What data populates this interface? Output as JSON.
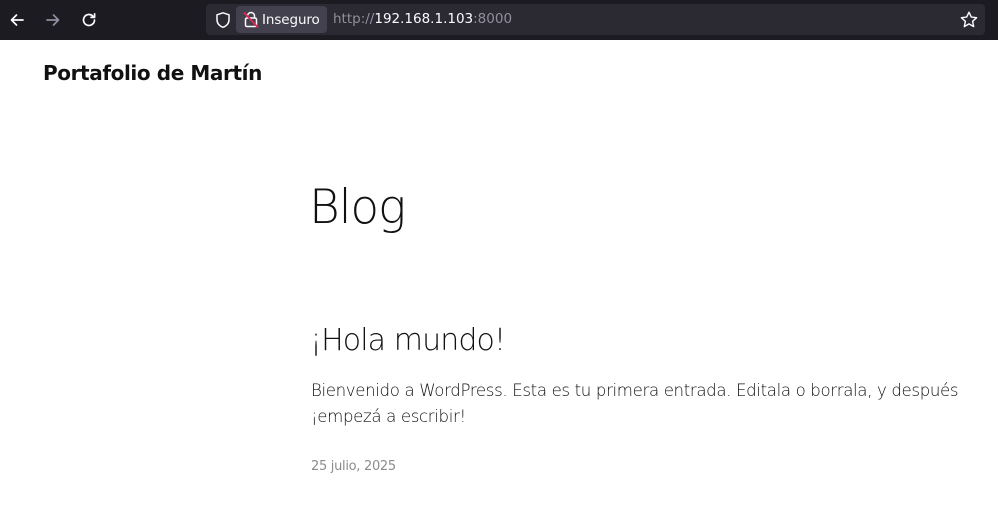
{
  "browser": {
    "back_icon": "arrow-left-icon",
    "forward_icon": "arrow-right-icon",
    "reload_icon": "reload-icon",
    "tracking_icon": "shield-icon",
    "security_label": "Inseguro",
    "security_icon": "broken-lock-icon",
    "url_scheme": "http://",
    "url_host": "192.168.1.103",
    "url_port": ":8000",
    "bookmark_icon": "star-icon",
    "colors": {
      "toolbar_bg": "#1c1b22",
      "urlbar_bg": "#2b2a33",
      "chip_bg": "#42414d",
      "insecure_accent": "#e22850"
    }
  },
  "site": {
    "title": "Portafolio de Martín"
  },
  "page": {
    "heading": "Blog"
  },
  "posts": [
    {
      "title": "¡Hola mundo!",
      "excerpt": "Bienvenido a WordPress. Esta es tu primera entrada. Editala o borrala, y después ¡empezá a escribir!",
      "date": "25 julio, 2025"
    }
  ]
}
